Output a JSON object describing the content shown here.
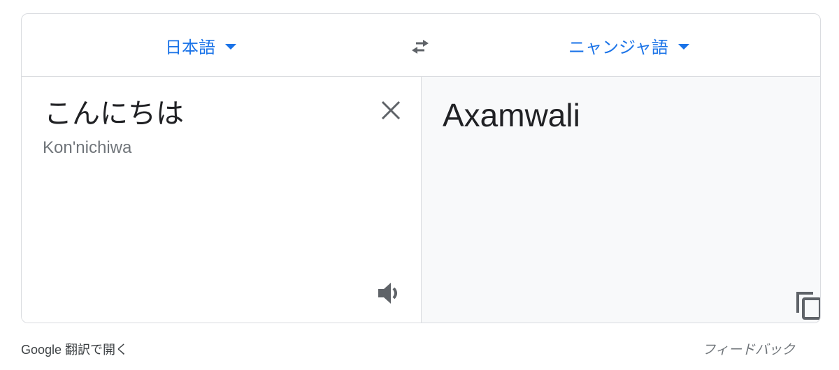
{
  "header": {
    "source_language": "日本語",
    "target_language": "ニャンジャ語",
    "icons": {
      "dropdown": "caret-down-icon",
      "swap": "swap-arrows-icon"
    }
  },
  "source": {
    "text": "こんにちは",
    "romanization": "Kon'nichiwa",
    "icons": {
      "clear": "close-icon",
      "listen": "speaker-icon"
    }
  },
  "target": {
    "text": "Axamwali",
    "icons": {
      "copy": "copy-icon"
    }
  },
  "footer": {
    "open_link": "Google 翻訳で開く",
    "feedback": "フィードバック"
  },
  "colors": {
    "accent": "#1a73e8",
    "border": "#dadce0",
    "target_background": "#f8f9fa",
    "icon": "#5f6368"
  }
}
